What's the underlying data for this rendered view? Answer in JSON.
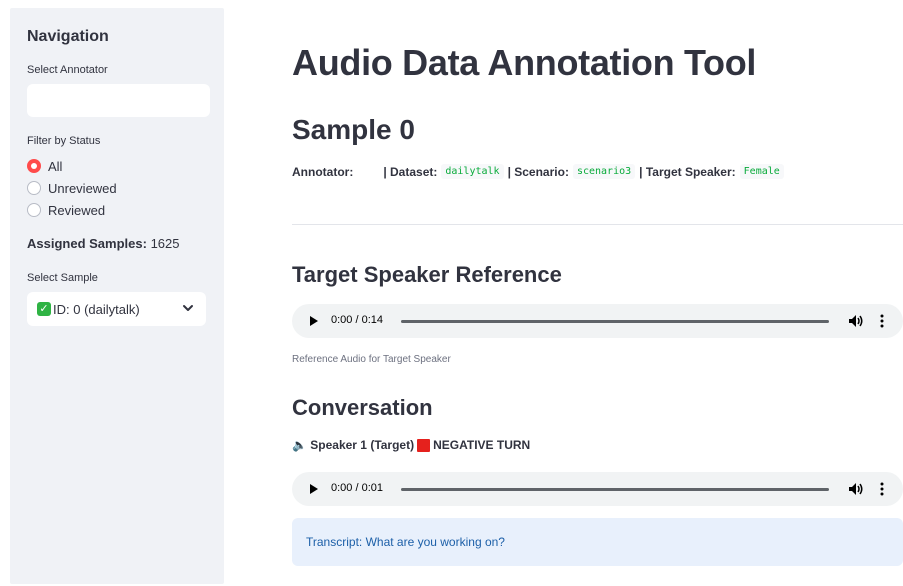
{
  "sidebar": {
    "title": "Navigation",
    "annotator_label": "Select Annotator",
    "annotator_value": "",
    "filter_label": "Filter by Status",
    "filter_options": [
      {
        "label": "All",
        "checked": true
      },
      {
        "label": "Unreviewed",
        "checked": false
      },
      {
        "label": "Reviewed",
        "checked": false
      }
    ],
    "assigned_label": "Assigned Samples:",
    "assigned_count": "1625",
    "sample_label": "Select Sample",
    "sample_value": "ID: 0 (dailytalk)"
  },
  "main": {
    "title": "Audio Data Annotation Tool",
    "sample_title": "Sample 0",
    "meta": {
      "annotator_label": "Annotator:",
      "dataset_label": "| Dataset:",
      "dataset_value": "dailytalk",
      "scenario_label": "| Scenario:",
      "scenario_value": "scenario3",
      "target_label": "| Target Speaker:",
      "target_value": "Female"
    },
    "reference_heading": "Target Speaker Reference",
    "reference_audio": {
      "time": "0:00 / 0:14"
    },
    "reference_caption": "Reference Audio for Target Speaker",
    "conversation_heading": "Conversation",
    "speaker_prefix": "🔈 Speaker 1 (Target)",
    "speaker_turn": "NEGATIVE TURN",
    "conversation_audio": {
      "time": "0:00 / 0:01"
    },
    "transcript": "Transcript: What are you working on?"
  },
  "colors": {
    "sidebar_bg": "#f0f2f6",
    "radio_accent": "#ff4b4b",
    "code_green": "#09ab3b",
    "transcript_bg": "#e8f0fc",
    "transcript_text": "#1c5fa8"
  }
}
